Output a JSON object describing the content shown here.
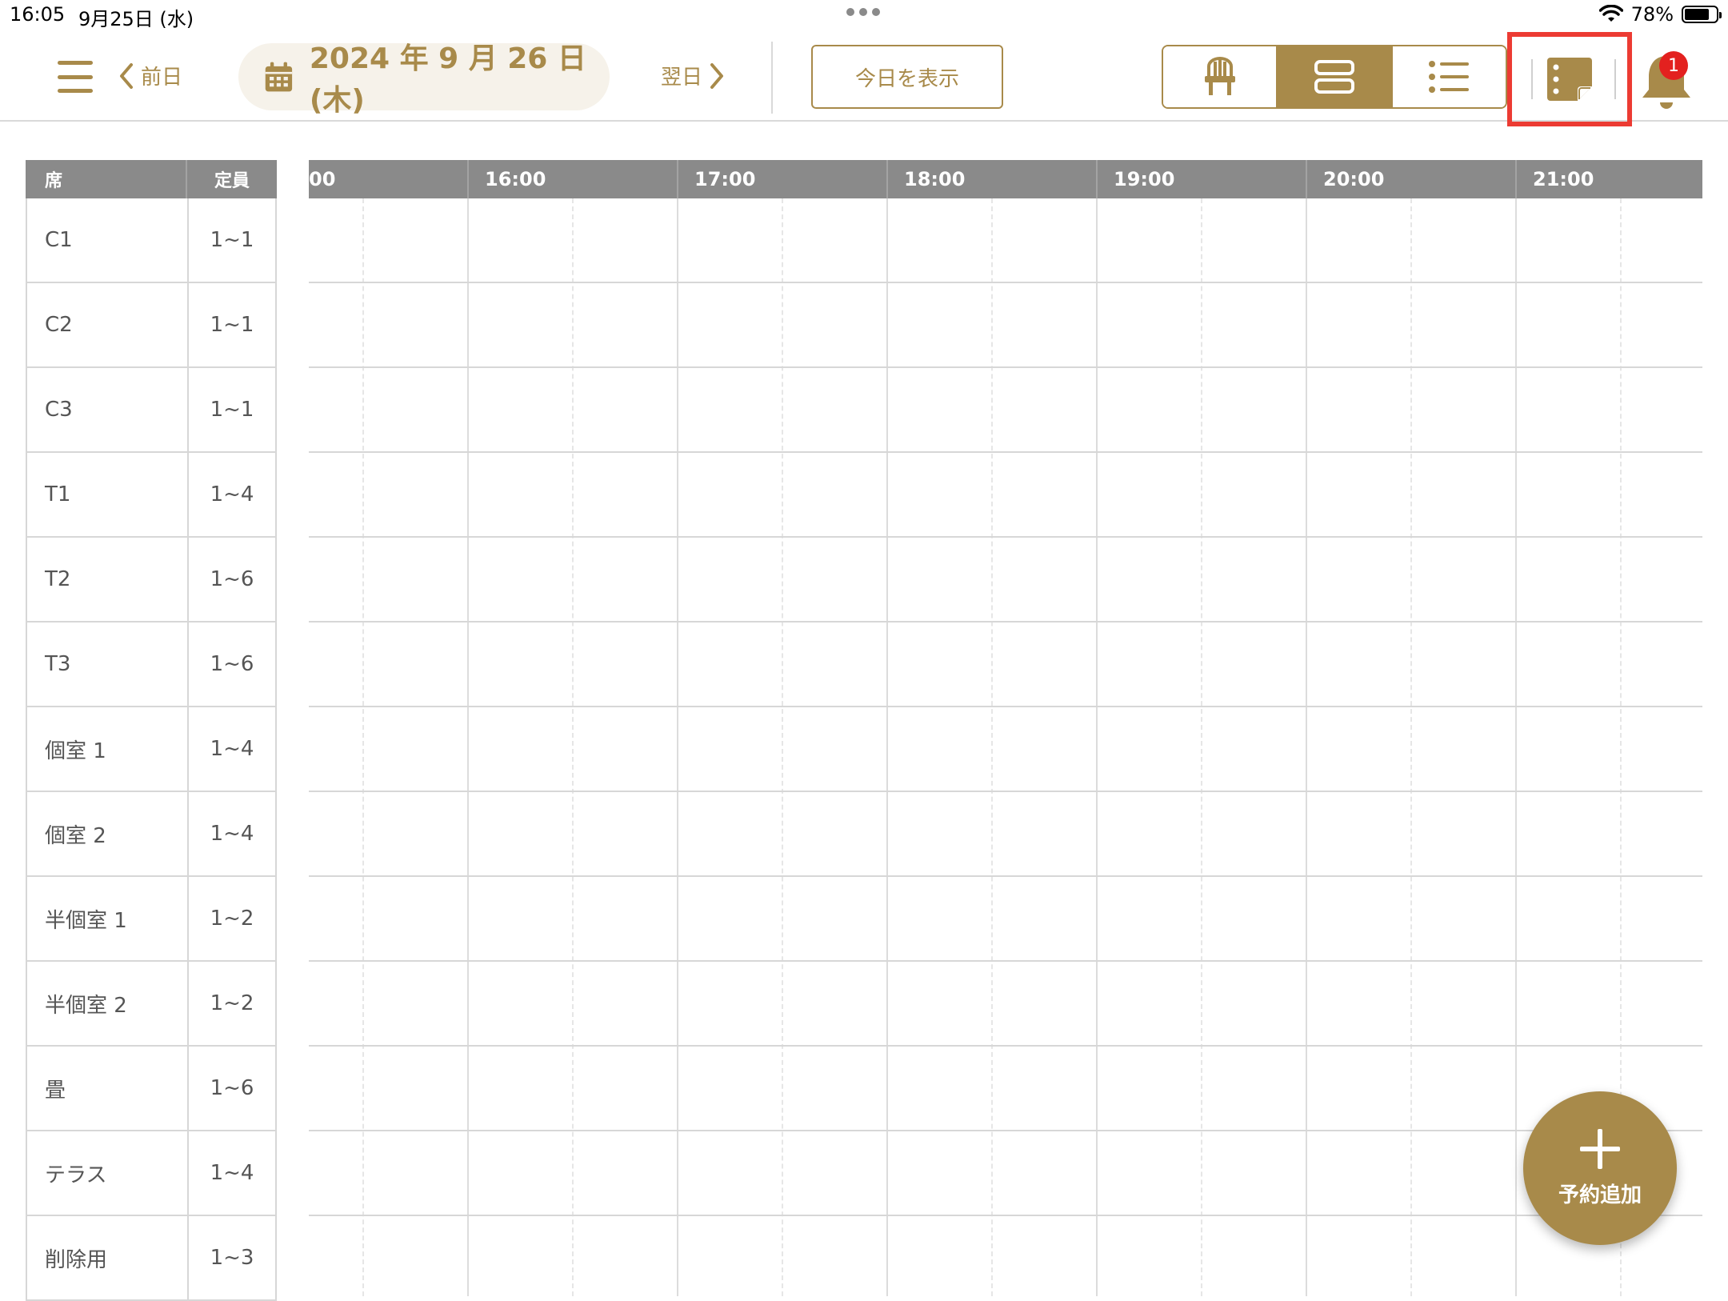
{
  "status_bar": {
    "time": "16:05",
    "date": "9月25日 (水)",
    "battery": "78%"
  },
  "toolbar": {
    "prev_label": "前日",
    "next_label": "翌日",
    "current_date": "2024 年 9 月 26 日 (木)",
    "today_button": "今日を表示",
    "view_modes": [
      "seat-view",
      "timeline-view",
      "list-view"
    ],
    "active_view": "timeline-view",
    "notification_count": "1",
    "accent_color": "#a88a4a",
    "highlight_color": "#ec3b33"
  },
  "seat_table": {
    "header_seat": "席",
    "header_capacity": "定員",
    "rows": [
      {
        "seat": "C1",
        "capacity": "1~1"
      },
      {
        "seat": "C2",
        "capacity": "1~1"
      },
      {
        "seat": "C3",
        "capacity": "1~1"
      },
      {
        "seat": "T1",
        "capacity": "1~4"
      },
      {
        "seat": "T2",
        "capacity": "1~6"
      },
      {
        "seat": "T3",
        "capacity": "1~6"
      },
      {
        "seat": "個室 1",
        "capacity": "1~4"
      },
      {
        "seat": "個室 2",
        "capacity": "1~4"
      },
      {
        "seat": "半個室 1",
        "capacity": "1~2"
      },
      {
        "seat": "半個室 2",
        "capacity": "1~2"
      },
      {
        "seat": "畳",
        "capacity": "1~6"
      },
      {
        "seat": "テラス",
        "capacity": "1~4"
      },
      {
        "seat": "削除用",
        "capacity": "1~3"
      }
    ]
  },
  "timeline": {
    "hours": [
      "00",
      "16:00",
      "17:00",
      "18:00",
      "19:00",
      "20:00",
      "21:00"
    ]
  },
  "fab": {
    "label": "予約追加"
  }
}
